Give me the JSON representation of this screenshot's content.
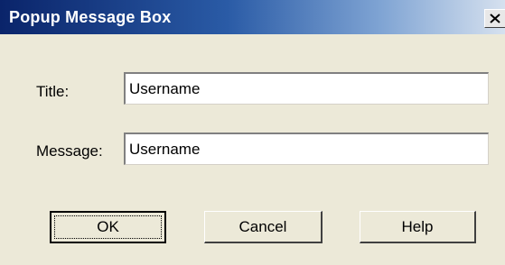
{
  "window": {
    "title": "Popup Message Box",
    "close_icon": "close-icon"
  },
  "form": {
    "title_label": "Title:",
    "title_value": "Username",
    "message_label": "Message:",
    "message_value": "Username"
  },
  "buttons": {
    "ok_label": "OK",
    "cancel_label": "Cancel",
    "help_label": "Help"
  },
  "colors": {
    "titlebar_start": "#0a246a",
    "dialog_background": "#ece9d8"
  }
}
